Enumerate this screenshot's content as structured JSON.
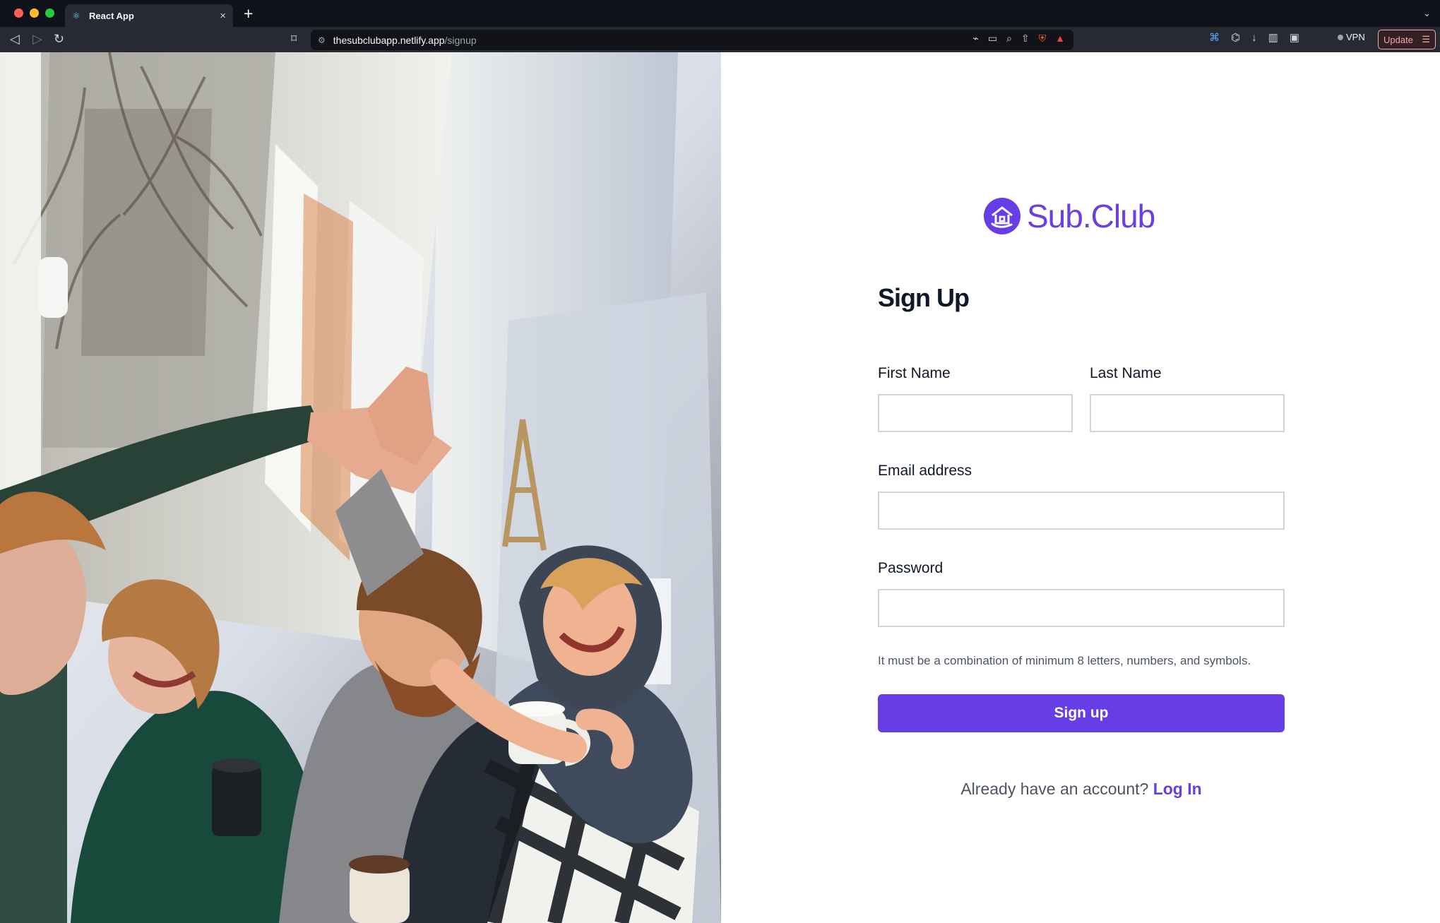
{
  "browser": {
    "tab_title": "React App",
    "url_host": "thesubclubapp.netlify.app",
    "url_path": "/signup",
    "vpn_label": "VPN",
    "update_label": "Update"
  },
  "brand": {
    "name": "Sub.Club",
    "accent_color": "#673de6"
  },
  "form": {
    "title": "Sign Up",
    "first_name_label": "First Name",
    "last_name_label": "Last Name",
    "email_label": "Email address",
    "password_label": "Password",
    "hint": "It must be a combination of minimum 8 letters, numbers, and symbols.",
    "submit_label": "Sign up",
    "login_prompt": "Already have an account?",
    "login_link": "Log In"
  },
  "icons": {
    "tab": "react-icon",
    "site": "settings-icon",
    "back": "back-arrow-icon",
    "forward": "forward-arrow-icon",
    "reload": "reload-icon",
    "bookmark": "bookmark-icon",
    "logo": "sub-club-logo-icon",
    "photo": "friends-high-five-photo"
  }
}
